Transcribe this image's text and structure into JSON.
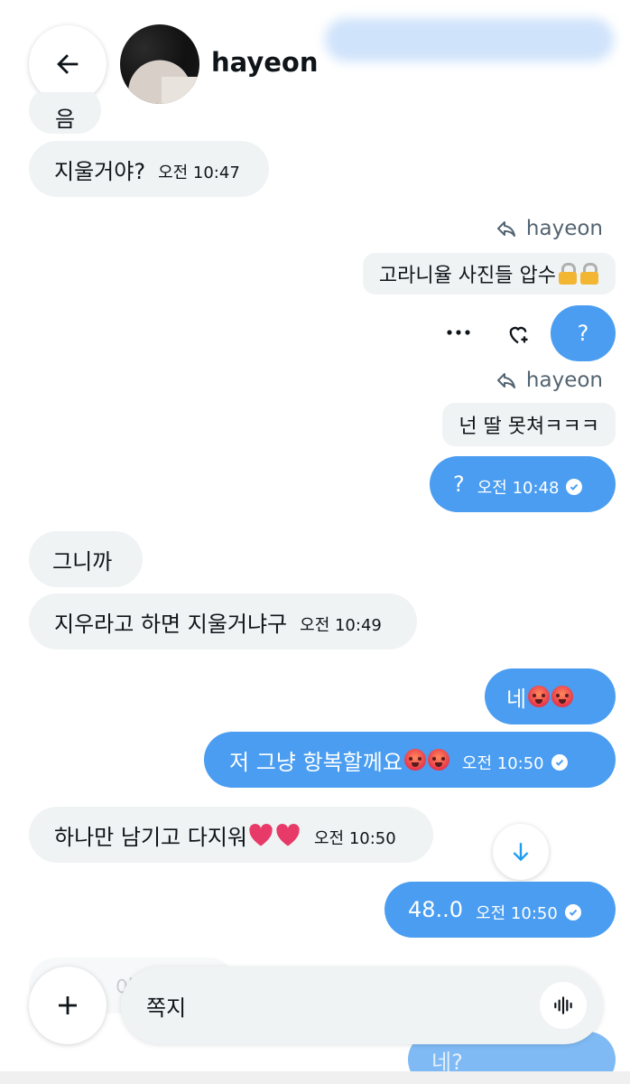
{
  "header": {
    "username": "hayeon"
  },
  "messages": {
    "m0": {
      "text": "음"
    },
    "m1": {
      "text": "지울거야?",
      "time": "오전 10:47"
    },
    "r1": {
      "reply_to": "hayeon",
      "quote_text": "고라니율 사진들 압수",
      "text": "?"
    },
    "r2": {
      "reply_to": "hayeon",
      "quote_text": "넌 딸 못쳐ㅋㅋㅋ",
      "text": "?",
      "time": "오전 10:48"
    },
    "m2": {
      "text": "그니까"
    },
    "m3": {
      "text": "지우라고 하면 지울거냐구",
      "time": "오전 10:49"
    },
    "m4": {
      "text": "네"
    },
    "m5": {
      "text": "저 그냥 항복할께요",
      "time": "오전 10:50"
    },
    "m6": {
      "text": "하나만 남기고 다지워",
      "time": "오전 10:50"
    },
    "m7": {
      "text": "48..0",
      "time": "오전 10:50"
    },
    "m8": {
      "text": "아"
    },
    "m9": {
      "text": "네?"
    }
  },
  "composer": {
    "placeholder": "쪽지"
  },
  "icons": {
    "back": "arrow-left-icon",
    "more": "more-horizontal-icon",
    "react": "heart-plus-icon",
    "reply": "reply-arrow-icon",
    "scroll_down": "arrow-down-icon",
    "add": "plus-icon",
    "voice": "voice-wave-icon"
  },
  "colors": {
    "outgoing_bubble": "#4a9df0",
    "incoming_bubble": "#eff3f4",
    "accent": "#1d9bf0"
  }
}
